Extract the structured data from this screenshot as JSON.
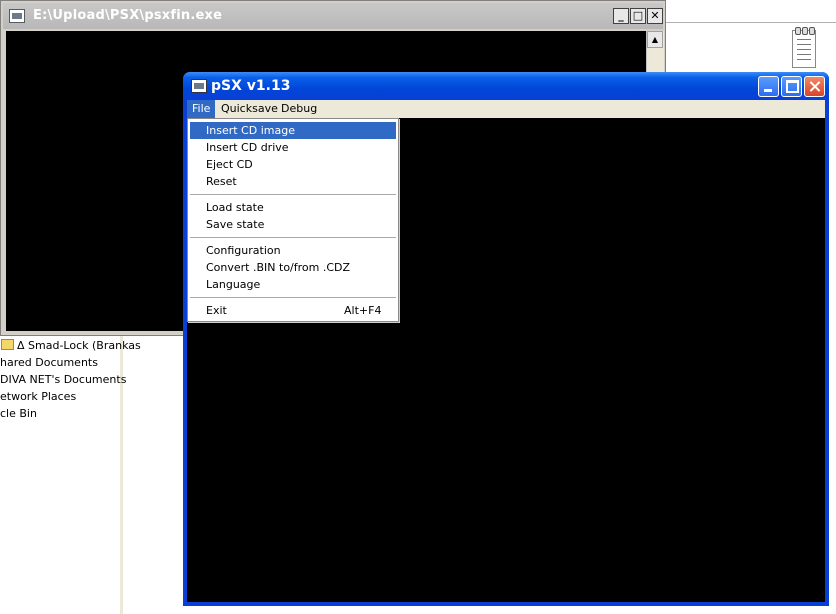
{
  "console_window": {
    "title": "E:\\Upload\\PSX\\psxfin.exe",
    "buttons": {
      "minimize": "_",
      "maximize": "□",
      "close": "✕"
    },
    "icon": "console-window-icon"
  },
  "explorer_tree": {
    "items": [
      "Δ Smad-Lock (Brankas",
      "hared Documents",
      "DIVA NET's Documents",
      "etwork Places",
      "cle Bin"
    ]
  },
  "psx_window": {
    "title": "pSX v1.13",
    "icon": "psx-app-icon",
    "menu": [
      "File",
      "Quicksave",
      "Debug"
    ],
    "title_colors": {
      "bar": "#0a3fd6",
      "close": "#d9442a"
    }
  },
  "file_menu": {
    "groups": [
      [
        {
          "label": "Insert CD image",
          "shortcut": ""
        },
        {
          "label": "Insert CD drive",
          "shortcut": ""
        },
        {
          "label": "Eject CD",
          "shortcut": ""
        },
        {
          "label": "Reset",
          "shortcut": ""
        }
      ],
      [
        {
          "label": "Load state",
          "shortcut": ""
        },
        {
          "label": "Save state",
          "shortcut": ""
        }
      ],
      [
        {
          "label": "Configuration",
          "shortcut": ""
        },
        {
          "label": "Convert .BIN to/from .CDZ",
          "shortcut": ""
        },
        {
          "label": "Language",
          "shortcut": ""
        }
      ],
      [
        {
          "label": "Exit",
          "shortcut": "Alt+F4"
        }
      ]
    ],
    "highlighted": "Insert CD image",
    "highlight_color": "#316ac5"
  }
}
